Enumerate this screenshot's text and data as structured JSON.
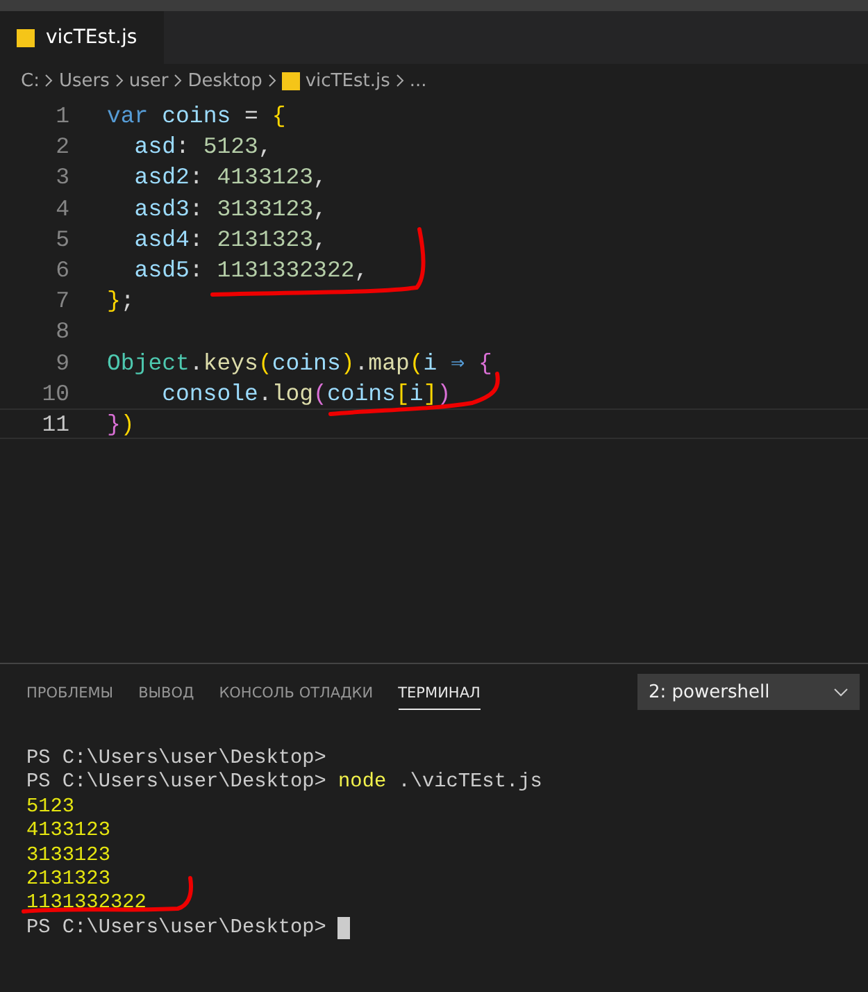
{
  "editor": {
    "tabs": [
      {
        "label": "vicTEst.js",
        "selected": true
      }
    ],
    "breadcrumb": [
      "C:",
      "Users",
      "user",
      "Desktop",
      "vicTEst.js",
      "..."
    ],
    "lines": [
      {
        "number": "1",
        "active": false,
        "tokens": [
          {
            "kind": "keyword",
            "text": "var "
          },
          {
            "kind": "variable",
            "text": "coins "
          },
          {
            "kind": "plain",
            "text": "= "
          },
          {
            "kind": "brace",
            "text": "{"
          }
        ]
      },
      {
        "number": "2",
        "active": false,
        "tokens": [
          {
            "kind": "variable",
            "text": "  asd"
          },
          {
            "kind": "plain",
            "text": ": "
          },
          {
            "kind": "number",
            "text": "5123"
          },
          {
            "kind": "plain",
            "text": ","
          }
        ]
      },
      {
        "number": "3",
        "active": false,
        "tokens": [
          {
            "kind": "variable",
            "text": "  asd2"
          },
          {
            "kind": "plain",
            "text": ": "
          },
          {
            "kind": "number",
            "text": "4133123"
          },
          {
            "kind": "plain",
            "text": ","
          }
        ]
      },
      {
        "number": "4",
        "active": false,
        "tokens": [
          {
            "kind": "variable",
            "text": "  asd3"
          },
          {
            "kind": "plain",
            "text": ": "
          },
          {
            "kind": "number",
            "text": "3133123"
          },
          {
            "kind": "plain",
            "text": ","
          }
        ]
      },
      {
        "number": "5",
        "active": false,
        "tokens": [
          {
            "kind": "variable",
            "text": "  asd4"
          },
          {
            "kind": "plain",
            "text": ": "
          },
          {
            "kind": "number",
            "text": "2131323"
          },
          {
            "kind": "plain",
            "text": ","
          }
        ]
      },
      {
        "number": "6",
        "active": false,
        "tokens": [
          {
            "kind": "variable",
            "text": "  asd5"
          },
          {
            "kind": "plain",
            "text": ": "
          },
          {
            "kind": "number",
            "text": "1131332322"
          },
          {
            "kind": "plain",
            "text": ","
          }
        ]
      },
      {
        "number": "7",
        "active": false,
        "tokens": [
          {
            "kind": "brace",
            "text": "}"
          },
          {
            "kind": "plain",
            "text": ";"
          }
        ]
      },
      {
        "number": "8",
        "active": false
      },
      {
        "number": "9",
        "active": false,
        "tokens": [
          {
            "kind": "class",
            "text": "Object"
          },
          {
            "kind": "plain",
            "text": "."
          },
          {
            "kind": "function",
            "text": "keys"
          },
          {
            "kind": "brace",
            "text": "("
          },
          {
            "kind": "variable",
            "text": "coins"
          },
          {
            "kind": "brace",
            "text": ")"
          },
          {
            "kind": "plain",
            "text": "."
          },
          {
            "kind": "function",
            "text": "map"
          },
          {
            "kind": "brace",
            "text": "("
          },
          {
            "kind": "variable",
            "text": "i "
          },
          {
            "kind": "arrow",
            "text": "⇒ "
          },
          {
            "kind": "brace2",
            "text": "{"
          }
        ]
      },
      {
        "number": "10",
        "active": false,
        "tokens": [
          {
            "kind": "variable",
            "text": "    console"
          },
          {
            "kind": "plain",
            "text": "."
          },
          {
            "kind": "function",
            "text": "log"
          },
          {
            "kind": "brace2",
            "text": "("
          },
          {
            "kind": "variable",
            "text": "coins"
          },
          {
            "kind": "brace3",
            "text": "["
          },
          {
            "kind": "variable",
            "text": "i"
          },
          {
            "kind": "brace3",
            "text": "]"
          },
          {
            "kind": "brace2",
            "text": ")"
          }
        ]
      },
      {
        "number": "11",
        "active": true,
        "tokens": [
          {
            "kind": "brace2",
            "text": "}"
          },
          {
            "kind": "brace",
            "text": ")"
          }
        ]
      }
    ]
  },
  "panel": {
    "tabs": [
      {
        "label": "ПРОБЛЕМЫ",
        "selected": false
      },
      {
        "label": "ВЫВОД",
        "selected": false
      },
      {
        "label": "КОНСОЛЬ ОТЛАДКИ",
        "selected": false
      },
      {
        "label": "ТЕРМИНАЛ",
        "selected": true
      }
    ],
    "terminal_select": "2: powershell",
    "lines": [
      {
        "kind": "prompt",
        "prompt": "PS C:\\Users\\user\\Desktop>"
      },
      {
        "kind": "prompt",
        "prompt": "PS C:\\Users\\user\\Desktop>",
        "command": "node",
        "args": ".\\vicTEst.js"
      },
      {
        "kind": "output",
        "text": "5123"
      },
      {
        "kind": "output",
        "text": "4133123"
      },
      {
        "kind": "output",
        "text": "3133123"
      },
      {
        "kind": "output",
        "text": "2131323"
      },
      {
        "kind": "output",
        "text": "1131332322"
      },
      {
        "kind": "cursor",
        "prompt": "PS C:\\Users\\user\\Desktop>"
      }
    ]
  }
}
